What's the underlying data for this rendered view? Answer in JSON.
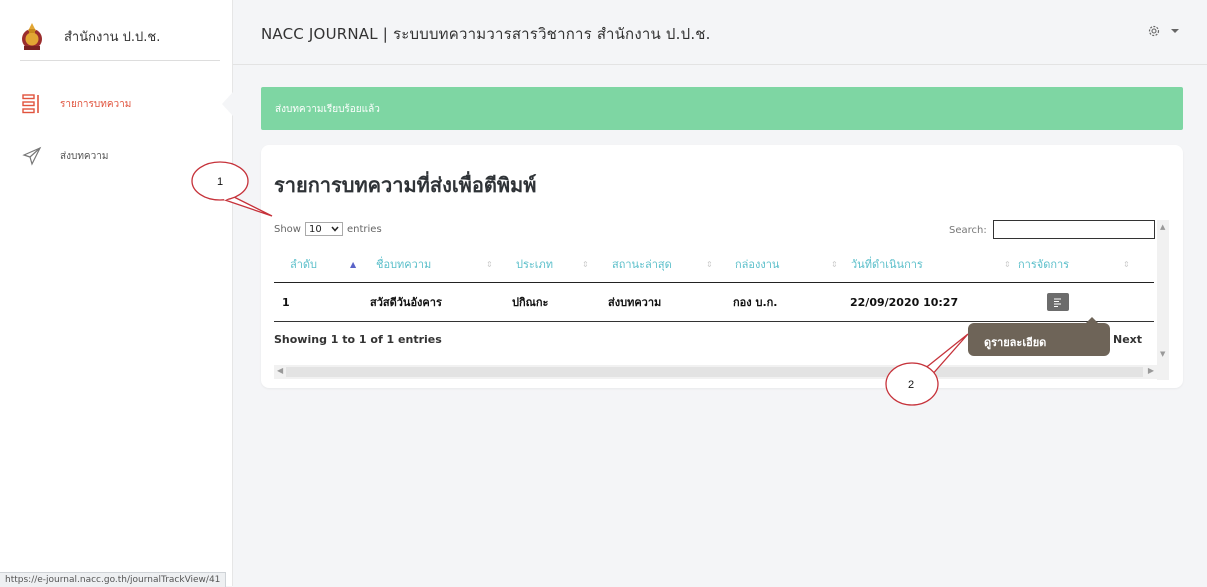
{
  "sidebar": {
    "brand_name": "สำนักงาน ป.ป.ช.",
    "items": [
      {
        "label": "รายการบทความ",
        "icon": "list-icon",
        "active": true
      },
      {
        "label": "ส่งบทความ",
        "icon": "send-icon",
        "active": false
      }
    ]
  },
  "header": {
    "title": "NACC JOURNAL | ระบบบทความวารสารวิชาการ สำนักงาน ป.ป.ช.",
    "settings_icon": "gear-icon"
  },
  "alert": {
    "text": "ส่งบทความเรียบร้อยแล้ว",
    "color": "#7ed6a3"
  },
  "card": {
    "title": "รายการบทความที่ส่งเพื่อตีพิมพ์",
    "show_prefix": "Show",
    "show_value": "10",
    "show_suffix": "entries",
    "search_label": "Search:",
    "search_value": "",
    "columns": [
      "ลำดับ",
      "ชื่อบทความ",
      "ประเภท",
      "สถานะล่าสุด",
      "กล่องงาน",
      "วันที่ดำเนินการ",
      "การจัดการ"
    ],
    "rows": [
      {
        "no": "1",
        "title": "สวัสดีวันอังคาร",
        "type": "ปกิณกะ",
        "status": "ส่งบทความ",
        "box": "กอง บ.ก.",
        "date": "22/09/2020 10:27",
        "action_icon": "details-icon"
      }
    ],
    "info": "Showing 1 to 1 of 1 entries",
    "next_label": "Next",
    "tooltip": "ดูรายละเอียด"
  },
  "callouts": [
    "1",
    "2"
  ],
  "status_url": "https://e-journal.nacc.go.th/journalTrackView/41",
  "colors": {
    "accent_header": "#5bbfca",
    "active_nav": "#e0533d",
    "tooltip": "#6e6458"
  }
}
